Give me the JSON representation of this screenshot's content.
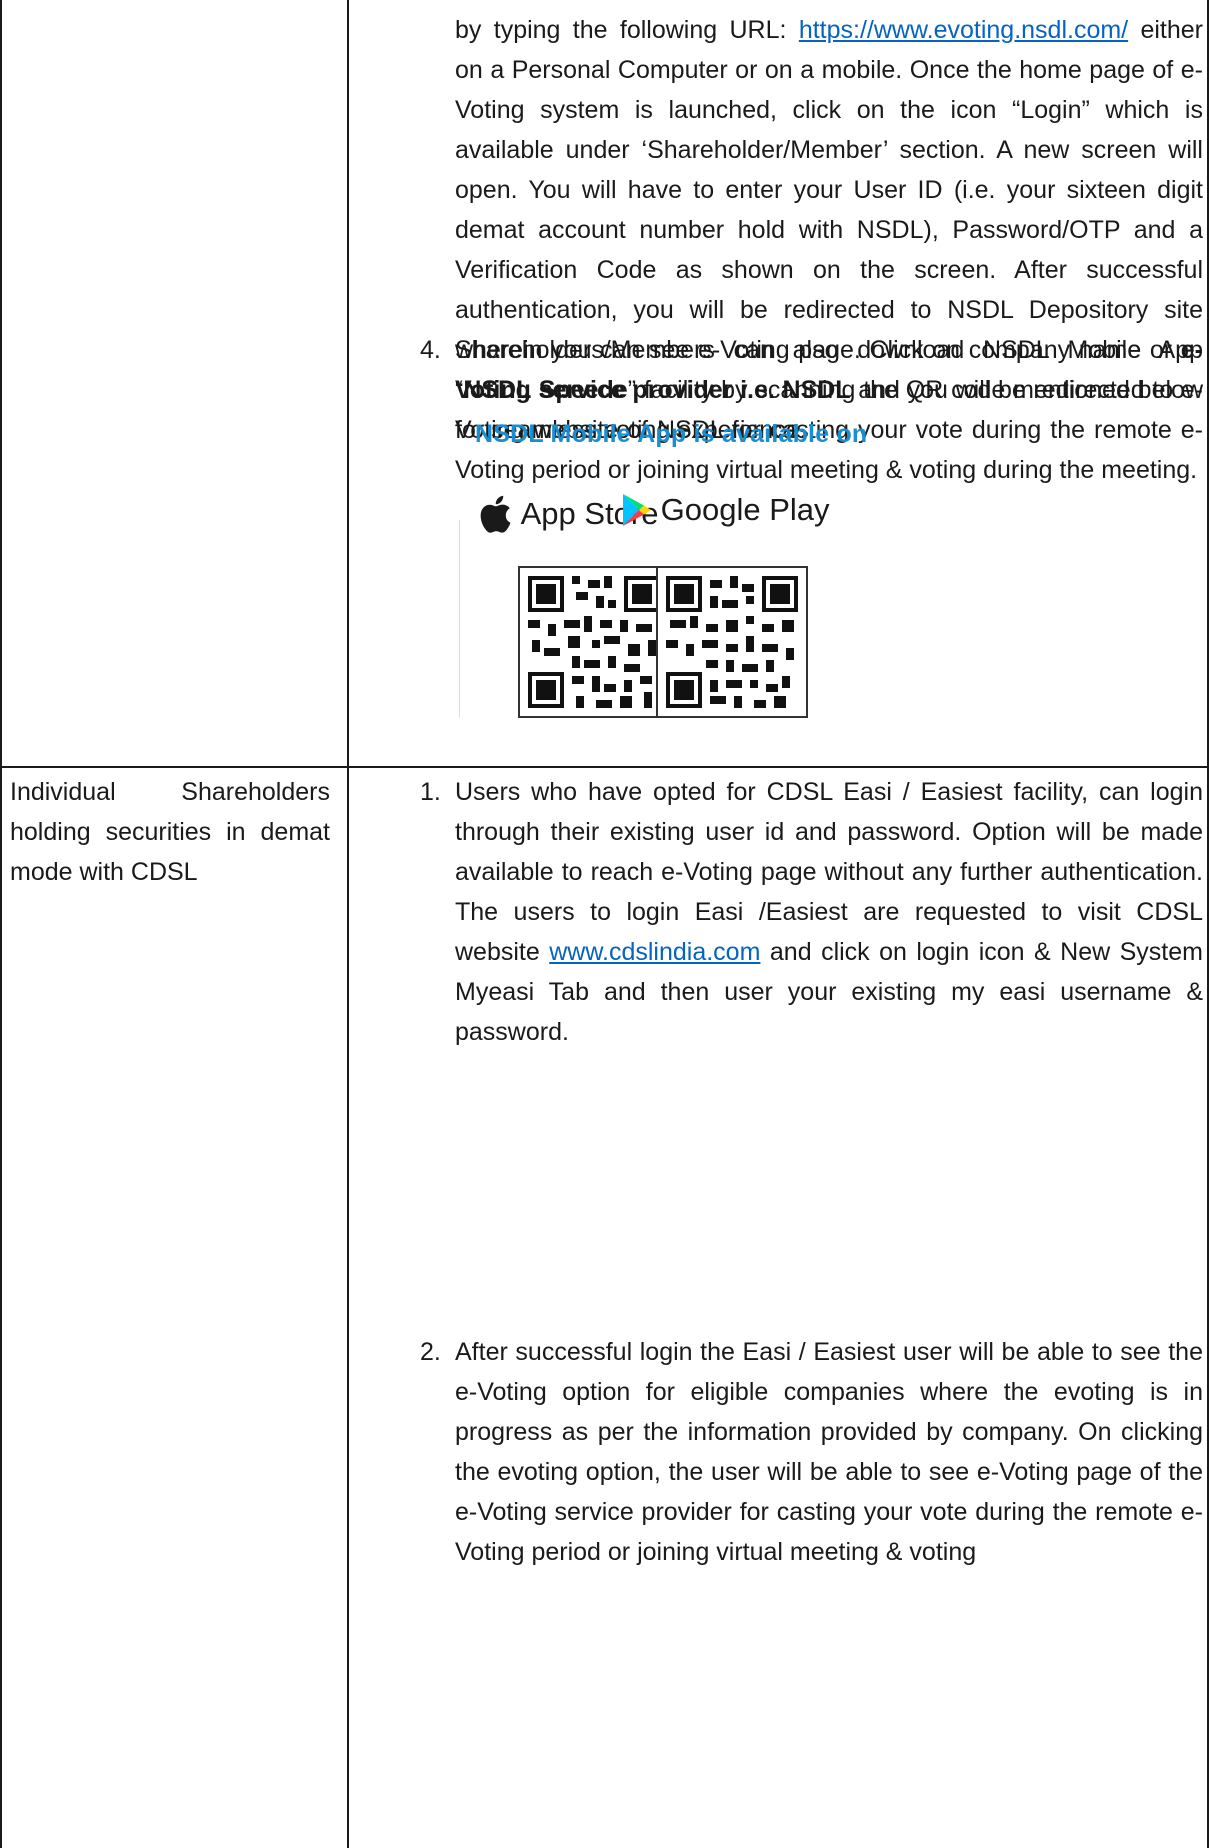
{
  "row1": {
    "para_top_text_a": "by typing the following URL: ",
    "link_nsdl": "https://www.evoting.nsdl.com/",
    "para_top_text_b": " either on a Personal Computer or on a mobile. Once the home page of e-Voting system is launched, click on the icon “Login” which is available under ‘Shareholder/Member’ section. A new screen will open. You will have to enter your User ID (i.e. your sixteen digit demat account number hold with NSDL), Password/OTP and a Verification Code as shown on the screen. After successful authentication, you will be redirected to NSDL Depository site wherein you can see e-Voting page. Click on company name or ",
    "bold_provider": "e-Voting service provider i.e. NSDL",
    "para_top_text_c": " and you will be redirected to e-Voting website of NSDL for casting your vote during the remote e-Voting period or joining virtual meeting & voting during the meeting.",
    "item4_number": "4.",
    "item4_text_a": "Shareholders/Members can also download NSDL Mobile App “",
    "item4_bold": "NSDL Speede",
    "item4_text_b": "” facility by scanning the QR code mentioned below for seamless voting experience.",
    "app_heading": "NSDL Mobile App is available on",
    "appstore_label": "App Store",
    "googleplay_label": "Google Play",
    "colors": {
      "link": "#0563c1",
      "app_heading": "#1a8ed1"
    },
    "icons": [
      "apple-icon",
      "google-play-icon",
      "qr-code-icon"
    ]
  },
  "row2": {
    "left_cell": "Individual Shareholders holding securities in demat mode with CDSL",
    "item1_number": "1.",
    "item1_text_a": "Users who have opted for CDSL Easi / Easiest facility, can login through their existing user id and password. Option will be made available to reach e-Voting page without any further authentication. The users to login Easi /Easiest are requested to visit CDSL website ",
    "link_cdsl": "www.cdslindia.com",
    "item1_text_b": " and click on login icon & New System Myeasi Tab and then user your existing my easi username & password.",
    "item2_number": "2.",
    "item2_text": "After successful login the Easi / Easiest user will be able to see the e-Voting option for eligible companies where the evoting is in progress as per the information provided by company. On clicking the evoting option, the user will be able to see e-Voting page of the e-Voting service provider for casting your vote during the remote e-Voting period or joining virtual meeting & voting"
  }
}
